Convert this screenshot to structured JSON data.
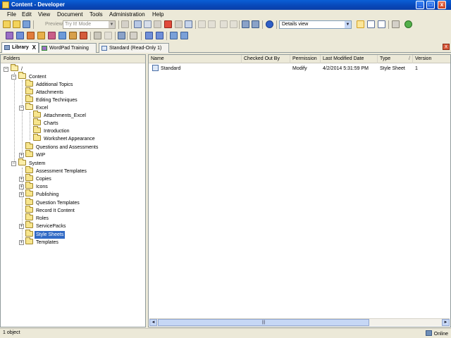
{
  "window": {
    "title": "Content - Developer",
    "minimize": "_",
    "maximize": "□",
    "close": "x"
  },
  "menu": [
    "File",
    "Edit",
    "View",
    "Document",
    "Tools",
    "Administration",
    "Help"
  ],
  "toolbar": {
    "preview_label": "Preview",
    "mode_value": "Try It! Mode",
    "view_value": "Details view",
    "dropdown_arrow": "▼"
  },
  "tabs": [
    {
      "label": "Library",
      "close": "X"
    },
    {
      "label": "WordPad Training"
    },
    {
      "label": "Standard (Read-Only 1)"
    }
  ],
  "tab_strip_close": "x",
  "folders": {
    "header": "Folders",
    "expand_symbol": "+",
    "collapse_symbol": "−",
    "root": "/",
    "items": [
      "Content",
      "Additional Topics",
      "Attachments",
      "Editing Techniques",
      "Excel",
      "Attachments_Excel",
      "Charts",
      "Introduction",
      "Worksheet Appearance",
      "Questions and Assessments",
      "WIP",
      "System",
      "Assessment Templates",
      "Copies",
      "Icons",
      "Publishing",
      "Question Templates",
      "Record It Content",
      "Roles",
      "ServicePacks",
      "Style Sheets",
      "Templates"
    ]
  },
  "list": {
    "columns": [
      "Name",
      "Checked Out By",
      "Permission",
      "Last Modified Date",
      "Type",
      "Version"
    ],
    "sort_arrow": "/",
    "rows": [
      {
        "name": "Standard",
        "checked_out_by": "",
        "permission": "Modify",
        "modified": "4/2/2014 5:31:59 PM",
        "type": "Style Sheet",
        "version": "1"
      }
    ],
    "scroll_left": "◄",
    "scroll_right": "►",
    "scroll_grip": "|||"
  },
  "status": {
    "left": "1 object",
    "right": "Online"
  }
}
